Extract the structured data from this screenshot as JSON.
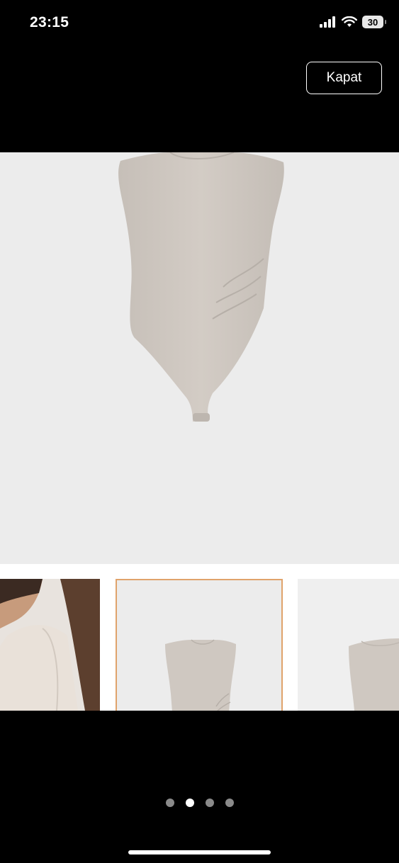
{
  "status_bar": {
    "time": "23:15",
    "battery_level": "30",
    "icons": [
      "cellular-signal-icon",
      "wifi-icon",
      "battery-icon"
    ]
  },
  "header": {
    "close_label": "Kapat"
  },
  "gallery": {
    "main_image": "beige-sleeveless-bodysuit",
    "thumbnails": [
      "model-wearing-bodysuit",
      "bodysuit-front",
      "bodysuit-side"
    ],
    "selected_thumbnail": 1,
    "page_count": 4,
    "current_page": 2
  },
  "colors": {
    "selection_border": "#e0a36b",
    "image_background": "#ececec",
    "garment": "#cfc8c1"
  }
}
